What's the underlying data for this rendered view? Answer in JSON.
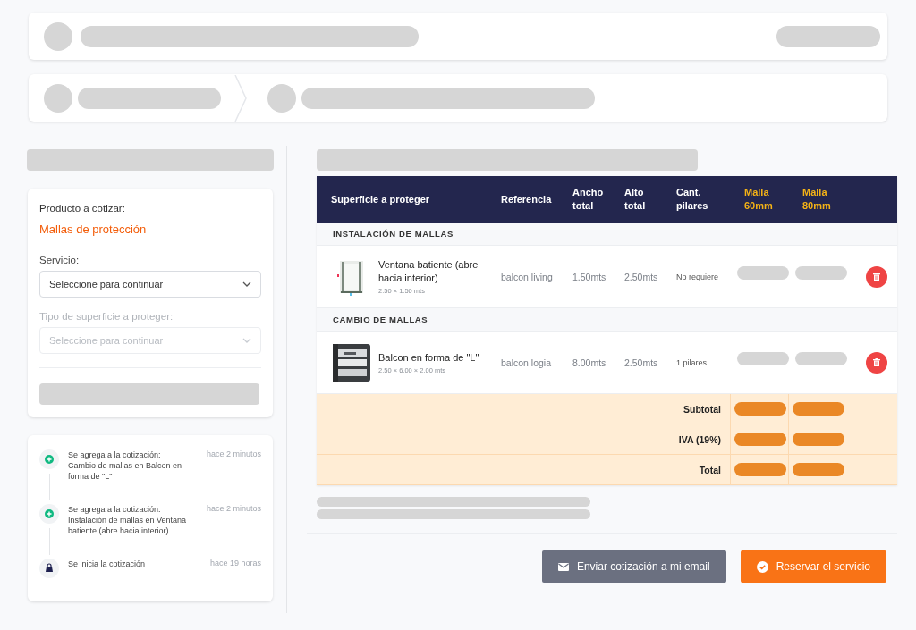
{
  "form": {
    "product_label": "Producto a cotizar:",
    "product_name": "Mallas de protección",
    "fields": [
      {
        "label": "Servicio:",
        "placeholder": "Seleccione para continuar",
        "disabled": false
      },
      {
        "label": "Tipo de superficie a proteger:",
        "placeholder": "Seleccione para continuar",
        "disabled": true
      }
    ]
  },
  "timeline": [
    {
      "kind": "added",
      "text": "Se agrega a la cotización: Cambio de mallas en Balcon en forma de \"L\"",
      "time": "hace 2 minutos"
    },
    {
      "kind": "added",
      "text": "Se agrega a la cotización: Instalación de mallas en Ventana batiente (abre hacia interior)",
      "time": "hace 2 minutos"
    },
    {
      "kind": "started",
      "text": "Se inicia la cotización",
      "time": "hace 19 horas"
    }
  ],
  "table": {
    "columns": [
      {
        "label": "Superficie a proteger",
        "accent": false
      },
      {
        "label": "Referencia",
        "accent": false
      },
      {
        "label": "Ancho total",
        "accent": false
      },
      {
        "label": "Alto total",
        "accent": false
      },
      {
        "label": "Cant. pilares",
        "accent": false
      },
      {
        "label": "Malla 60mm",
        "accent": true
      },
      {
        "label": "Malla 80mm",
        "accent": true
      }
    ],
    "rows": [
      {
        "kind": "section",
        "title": "INSTALACIÓN DE MALLAS"
      },
      {
        "kind": "item",
        "name": "Ventana batiente (abre hacia interior)",
        "size": "2.50 × 1.50 mts",
        "reference": "balcon living",
        "width": "1.50mts",
        "height": "2.50mts",
        "pillars": "No requiere"
      },
      {
        "kind": "section",
        "title": "CAMBIO DE MALLAS"
      },
      {
        "kind": "item",
        "name": "Balcon en forma de \"L\"",
        "size": "2.50 × 6.00 × 2.00 mts",
        "reference": "balcon logia",
        "width": "8.00mts",
        "height": "2.50mts",
        "pillars": "1 pilares"
      }
    ],
    "summary": [
      "Subtotal",
      "IVA (19%)",
      "Total"
    ]
  },
  "buttons": [
    {
      "kind": "email",
      "label": "Enviar cotización a mi email"
    },
    {
      "kind": "reserve",
      "label": "Reservar el servicio"
    }
  ]
}
